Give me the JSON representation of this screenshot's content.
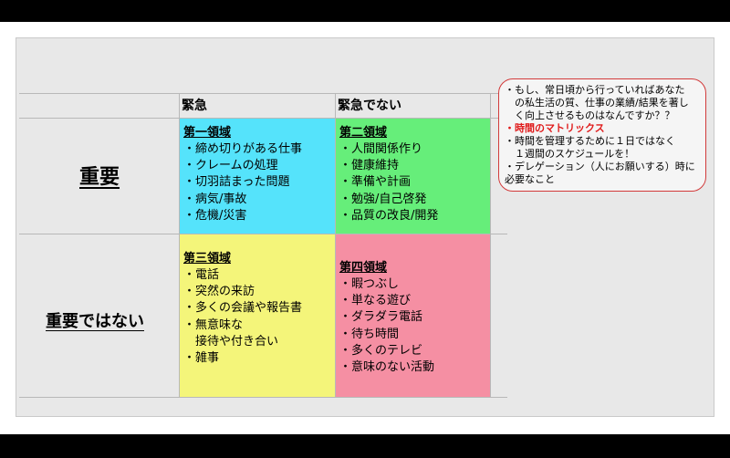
{
  "matrix": {
    "col_header_urgent": "緊急",
    "col_header_not_urgent": "緊急でない",
    "row_important": "重要",
    "row_not_important": "重要ではない",
    "quadrants": [
      {
        "title": "第一領域",
        "items": [
          "・締め切りがある仕事",
          "・クレームの処理",
          "・切羽詰まった問題",
          "・病気/事故",
          "・危機/災害"
        ],
        "color": "#55e3fb"
      },
      {
        "title": "第二領域",
        "items": [
          "・人間関係作り",
          "・健康維持",
          "・準備や計画",
          "・勉強/自己啓発",
          "・品質の改良/開発"
        ],
        "color": "#66ee7a"
      },
      {
        "title": "第三領域",
        "items": [
          "・電話",
          "・突然の来訪",
          "・多くの会議や報告書",
          "・無意味な",
          "　接待や付き合い",
          "・雑事"
        ],
        "color": "#f4f57a"
      },
      {
        "title": "第四領域",
        "items": [
          "・暇つぶし",
          "・単なる遊び",
          "・ダラダラ電話",
          "・待ち時間",
          "・多くのテレビ",
          "・意味のない活動"
        ],
        "color": "#f58fa3"
      }
    ]
  },
  "note": {
    "lines": [
      "・もし、常日頃から行っていればあなた",
      "　の私生活の質、仕事の業績/結果を著し",
      "　く向上させるものはなんですか？？",
      "・時間のマトリックス",
      "・時間を管理するために１日ではなく",
      "　１週間のスケジュールを！",
      "・デレゲーション（人にお願いする）時に",
      "必要なこと"
    ],
    "highlight_color": "#e01b1b",
    "border_color": "#d23a3a"
  },
  "controls": {
    "icons": [
      "back-arrow-icon",
      "pen-icon",
      "slides-icon",
      "more-icon",
      "forward-arrow-icon"
    ]
  }
}
